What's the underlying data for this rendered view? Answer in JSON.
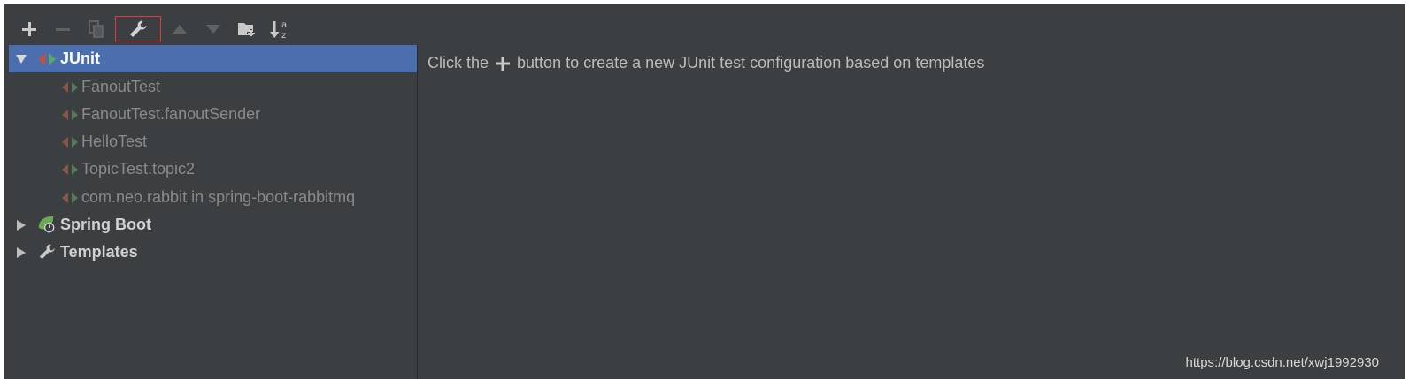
{
  "toolbar": {
    "buttons": [
      {
        "name": "add-icon"
      },
      {
        "name": "remove-icon"
      },
      {
        "name": "copy-icon"
      },
      {
        "name": "wrench-icon"
      },
      {
        "name": "move-up-icon"
      },
      {
        "name": "move-down-icon"
      },
      {
        "name": "new-folder-icon"
      },
      {
        "name": "sort-alphabetically-icon"
      }
    ],
    "sort_glyph_top": "a",
    "sort_glyph_bottom": "z"
  },
  "tree": {
    "junit": {
      "label": "JUnit"
    },
    "children": [
      {
        "label": "FanoutTest"
      },
      {
        "label": "FanoutTest.fanoutSender"
      },
      {
        "label": "HelloTest"
      },
      {
        "label": "TopicTest.topic2"
      },
      {
        "label": "com.neo.rabbit in spring-boot-rabbitmq"
      }
    ],
    "spring_boot": {
      "label": "Spring Boot"
    },
    "templates": {
      "label": "Templates"
    }
  },
  "message": {
    "before": "Click the",
    "after": "button to create a new JUnit test configuration based on templates"
  },
  "watermark": "https://blog.csdn.net/xwj1992930",
  "colors": {
    "background": "#3c3f41",
    "selection": "#4b6eaf",
    "highlight_border": "#e03a3a",
    "junit_red": "#c7503b",
    "junit_green": "#59a869"
  }
}
